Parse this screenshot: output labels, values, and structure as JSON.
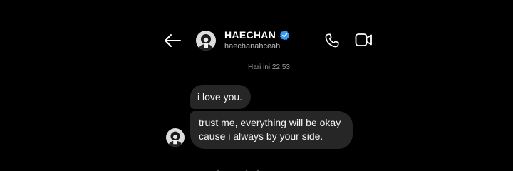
{
  "header": {
    "back_icon": "arrow-left-icon",
    "profile_name": "HAECHAN",
    "verified_icon": "verified-badge-icon",
    "handle": "haechanahceah",
    "call_icon": "phone-icon",
    "video_icon": "video-camera-icon"
  },
  "chat": {
    "timestamp": "Hari ini 22:53",
    "messages": [
      {
        "text": "i love you."
      },
      {
        "text": "trust me, everything will be okay cause i always by your side."
      }
    ]
  },
  "colors": {
    "background": "#000000",
    "bubble": "#262626",
    "verified": "#3897f0",
    "muted_text": "#9e9e9e"
  }
}
